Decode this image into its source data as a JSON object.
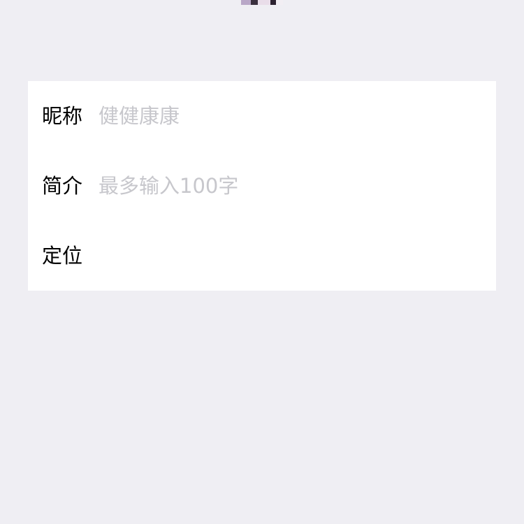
{
  "profile_form": {
    "nickname": {
      "label": "昵称",
      "placeholder": "健健康康",
      "value": ""
    },
    "bio": {
      "label": "简介",
      "placeholder": "最多输入100字",
      "value": ""
    },
    "location": {
      "label": "定位",
      "value": ""
    }
  },
  "colors": {
    "page_background": "#EFEEF3",
    "card_background": "#FFFFFF",
    "label_text": "#000000",
    "placeholder_text": "#C7C7CC"
  }
}
